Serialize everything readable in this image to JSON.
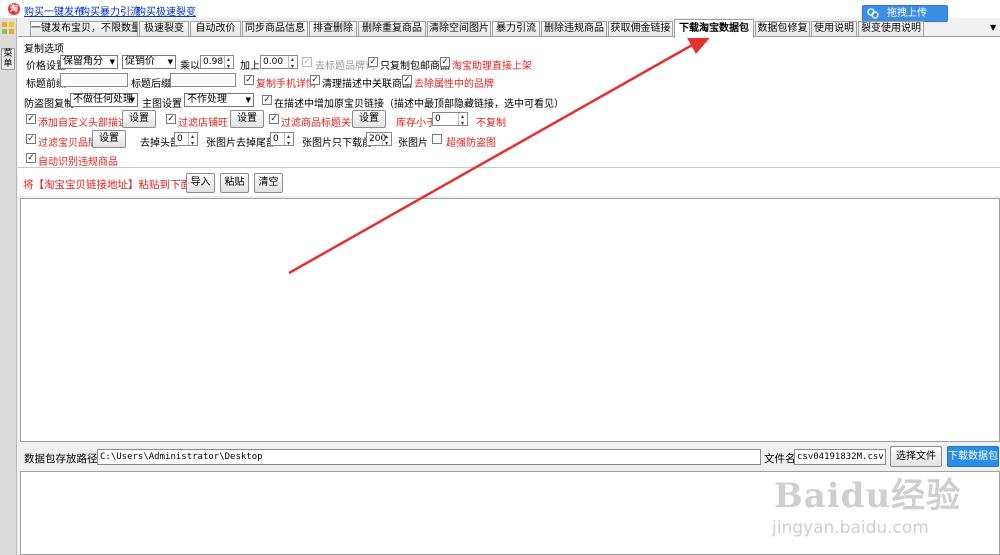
{
  "topbar": {
    "logo_text": "淘",
    "links": [
      "购买一键发布",
      "购买暴力引流",
      "购买极速裂变"
    ],
    "upload_button": "拖拽上传"
  },
  "leftstrip": {
    "vertical_label": "菜单"
  },
  "tabs": [
    "一键发布宝贝，不限数量",
    "极速裂变",
    "自动改价",
    "同步商品信息",
    "排查删除",
    "删除重复商品",
    "清除空间图片",
    "暴力引流",
    "删除违规商品",
    "获取佣金链接",
    "下载淘宝数据包",
    "数据包修复",
    "使用说明",
    "裂变使用说明"
  ],
  "active_tab": "下载淘宝数据包",
  "options": {
    "section_title": "复制选项",
    "price_label": "价格设置",
    "price_mode": "保留角分",
    "price_source": "促销价",
    "multiply_label": "乘以",
    "multiply_value": "0.98",
    "add_label": "加上",
    "add_value": "0.00",
    "cb_remove_title_brand": "去标题品牌词",
    "cb_only_free_shipping": "只复制包邮商品",
    "cb_direct_upload": "淘宝助理直接上架",
    "title_prefix_label": "标题前缀",
    "title_suffix_label": "标题后缀",
    "cb_copy_mobile_detail": "复制手机详情",
    "cb_clean_related": "清理描述中关联商品",
    "cb_remove_attr_brand": "去除属性中的品牌",
    "anti_theft_label": "防盗图复制",
    "anti_theft_value": "不做任何处理",
    "main_image_label": "主图设置",
    "main_image_value": "不作处理",
    "cb_add_original_link": "在描述中增加原宝贝链接（描述中最顶部隐藏链接，选中可看见）",
    "cb_add_custom_header": "添加自定义头部描述",
    "settings_btn": "设置",
    "cb_filter_shop": "过滤店铺旺",
    "cb_filter_title_keywords": "过滤商品标题关键",
    "stock_label": "库存小于",
    "stock_value": "0",
    "no_copy_label": "不复制",
    "cb_filter_brand": "过滤宝贝品牌",
    "remove_head_label": "去掉头部",
    "remove_head_value": "0",
    "images_label": "张图片",
    "remove_tail_label": "去掉尾部",
    "remove_tail_value": "0",
    "download_only_label": "张图片只下载前",
    "download_only_value": "200",
    "images_label2": "张图片",
    "cb_strong_anti_theft": "超强防盗图",
    "cb_auto_detect_violation": "自动识别违规商品"
  },
  "paste": {
    "label": "将【淘宝宝贝链接地址】粘贴到下面:",
    "import_btn": "导入",
    "paste_btn": "粘贴",
    "clear_btn": "清空"
  },
  "path": {
    "label": "数据包存放路径",
    "value": "C:\\Users\\Administrator\\Desktop",
    "filename_label": "文件名",
    "filename_value": "csv04191832M.csv",
    "choose_file_btn": "选择文件",
    "download_btn": "下载数据包"
  },
  "watermark": {
    "brand": "Baidu经验",
    "url": "jingyan.baidu.com"
  },
  "colors": {
    "accent": "#2a8ee8",
    "warning_text": "#e02020",
    "arrow": "#e53030",
    "link": "#0033cc"
  }
}
